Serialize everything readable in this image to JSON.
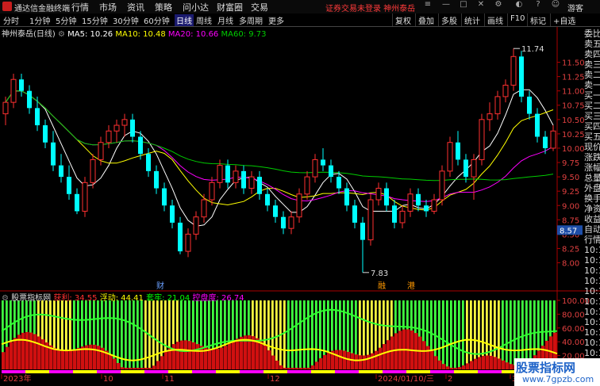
{
  "titlebar": {
    "app_name": "通达信金融终端",
    "menus": [
      "行情",
      "市场",
      "资讯",
      "策略",
      "问小达",
      "财富圈",
      "交易"
    ],
    "notice": "证券交易未登录 神州泰岳",
    "user": "游客"
  },
  "toolbar": {
    "periods": [
      "分时",
      "1分钟",
      "5分钟",
      "15分钟",
      "30分钟",
      "60分钟",
      "日线",
      "周线",
      "月线",
      "多周期",
      "更多"
    ],
    "active_period": "日线",
    "tools": [
      "复权",
      "叠加",
      "多股",
      "统计",
      "画线",
      "F10",
      "标记",
      "+自选"
    ]
  },
  "main_legend": {
    "stock": "神州泰岳(日线)",
    "ma5": "MA5: 10.26",
    "ma10": "MA10: 10.48",
    "ma20": "MA20: 10.66",
    "ma60": "MA60: 9.73"
  },
  "indicator_legend": {
    "name": "股票指标网",
    "profit": "获利: 34.55",
    "float": "浮动: 44.41",
    "trapped": "套牢: 21.04",
    "control": "控盘度: 26.74"
  },
  "colors": {
    "up": "#ff3030",
    "down": "#00ffff",
    "ma5": "#ffffff",
    "ma10": "#ffff00",
    "ma20": "#ff00ff",
    "ma60": "#00cc00"
  },
  "price_ticks": [
    "11.50",
    "11.25",
    "11.00",
    "10.75",
    "10.50",
    "10.25",
    "10.00",
    "9.75",
    "9.50",
    "9.25",
    "9.00",
    "8.75",
    "8.50",
    "8.25",
    "8.00"
  ],
  "indicator_ticks": [
    "100.00",
    "80.00",
    "60.00",
    "40.00",
    "20.00"
  ],
  "current_price_label": "8.57",
  "high_label": "11.74",
  "low_label": "7.83",
  "event_markers": [
    "财",
    "融",
    "港"
  ],
  "x_axis_labels": [
    "2023年",
    "10",
    "11",
    "12",
    "2024/01/10/三",
    "2",
    "3"
  ],
  "right_panel": [
    "委比",
    "卖五",
    "卖四",
    "卖三",
    "卖二",
    "卖一",
    "买一",
    "买二",
    "买三",
    "买四",
    "买五",
    "现价",
    "涨跌",
    "涨幅",
    "总量",
    "外盘",
    "换手",
    "净资",
    "收益",
    "自动",
    "行情",
    "10:11",
    "10:11",
    "10:11",
    "10:11",
    "10:11",
    "10:11",
    "10:11",
    "10:11",
    "10:11",
    "10:11",
    "10:11",
    "10:11"
  ],
  "watermark": {
    "line1": "股票指标网",
    "line2": "www.7gpzb.com"
  },
  "chart_data": {
    "type": "candlestick",
    "y_range": [
      7.8,
      11.95
    ],
    "candles": [
      [
        10.6,
        10.9,
        10.4,
        10.8
      ],
      [
        10.8,
        11.3,
        10.7,
        11.2
      ],
      [
        11.2,
        11.3,
        10.9,
        11.0
      ],
      [
        11.0,
        11.1,
        10.6,
        10.7
      ],
      [
        10.7,
        10.9,
        10.3,
        10.4
      ],
      [
        10.4,
        10.5,
        10.0,
        10.1
      ],
      [
        10.1,
        10.3,
        9.6,
        9.7
      ],
      [
        9.7,
        9.9,
        9.4,
        9.5
      ],
      [
        9.5,
        9.7,
        9.1,
        9.2
      ],
      [
        9.2,
        9.3,
        8.85,
        8.9
      ],
      [
        8.9,
        9.5,
        8.8,
        9.4
      ],
      [
        9.4,
        9.9,
        9.3,
        9.8
      ],
      [
        9.8,
        10.2,
        9.7,
        10.1
      ],
      [
        10.1,
        10.4,
        10.0,
        10.3
      ],
      [
        10.3,
        10.5,
        10.1,
        10.4
      ],
      [
        10.4,
        10.6,
        10.2,
        10.5
      ],
      [
        10.5,
        10.6,
        10.1,
        10.2
      ],
      [
        10.2,
        10.3,
        9.8,
        9.9
      ],
      [
        9.9,
        10.0,
        9.5,
        9.6
      ],
      [
        9.6,
        9.7,
        9.2,
        9.3
      ],
      [
        9.3,
        9.4,
        8.9,
        9.0
      ],
      [
        9.0,
        9.1,
        8.6,
        8.7
      ],
      [
        8.7,
        8.8,
        8.15,
        8.2
      ],
      [
        8.2,
        8.6,
        8.1,
        8.5
      ],
      [
        8.5,
        8.9,
        8.4,
        8.8
      ],
      [
        8.8,
        9.2,
        8.7,
        9.1
      ],
      [
        9.1,
        9.5,
        9.0,
        9.4
      ],
      [
        9.4,
        9.8,
        9.3,
        9.7
      ],
      [
        9.7,
        9.8,
        9.3,
        9.4
      ],
      [
        9.4,
        9.7,
        9.3,
        9.6
      ],
      [
        9.6,
        9.7,
        9.2,
        9.3
      ],
      [
        9.3,
        9.6,
        9.2,
        9.5
      ],
      [
        9.5,
        9.6,
        9.1,
        9.2
      ],
      [
        9.2,
        9.3,
        8.9,
        9.0
      ],
      [
        9.0,
        9.1,
        8.7,
        8.8
      ],
      [
        8.8,
        8.9,
        8.5,
        8.6
      ],
      [
        8.6,
        8.9,
        8.5,
        8.8
      ],
      [
        8.8,
        9.3,
        8.7,
        9.2
      ],
      [
        9.2,
        9.6,
        9.1,
        9.5
      ],
      [
        9.5,
        9.9,
        9.4,
        9.8
      ],
      [
        9.8,
        10.0,
        9.6,
        9.7
      ],
      [
        9.7,
        9.8,
        9.4,
        9.5
      ],
      [
        9.5,
        9.6,
        9.2,
        9.3
      ],
      [
        9.3,
        9.4,
        8.9,
        9.0
      ],
      [
        9.0,
        9.1,
        8.6,
        8.7
      ],
      [
        8.7,
        8.8,
        7.83,
        8.4
      ],
      [
        8.4,
        9.2,
        8.3,
        9.1
      ],
      [
        9.1,
        9.4,
        9.0,
        9.3
      ],
      [
        9.3,
        9.4,
        8.9,
        9.0
      ],
      [
        9.0,
        9.1,
        8.6,
        8.7
      ],
      [
        8.7,
        9.0,
        8.6,
        8.9
      ],
      [
        8.9,
        9.3,
        8.8,
        9.2
      ],
      [
        9.2,
        9.3,
        8.9,
        9.0
      ],
      [
        9.0,
        9.1,
        8.8,
        8.9
      ],
      [
        8.9,
        9.2,
        8.85,
        9.1
      ],
      [
        9.1,
        9.7,
        9.0,
        9.6
      ],
      [
        9.6,
        10.2,
        9.5,
        10.1
      ],
      [
        10.1,
        10.3,
        9.7,
        9.8
      ],
      [
        9.8,
        9.9,
        9.4,
        9.5
      ],
      [
        9.5,
        9.9,
        9.1,
        9.8
      ],
      [
        9.8,
        10.6,
        9.7,
        10.5
      ],
      [
        10.5,
        10.8,
        10.3,
        10.6
      ],
      [
        10.6,
        11.0,
        10.5,
        10.9
      ],
      [
        10.9,
        11.2,
        10.8,
        11.1
      ],
      [
        11.1,
        11.74,
        11.0,
        11.6
      ],
      [
        11.6,
        11.7,
        10.8,
        10.9
      ],
      [
        10.9,
        11.0,
        10.5,
        10.6
      ],
      [
        10.6,
        10.7,
        10.1,
        10.2
      ],
      [
        10.2,
        10.3,
        9.9,
        10.0
      ],
      [
        10.0,
        10.4,
        9.95,
        10.3
      ]
    ]
  }
}
